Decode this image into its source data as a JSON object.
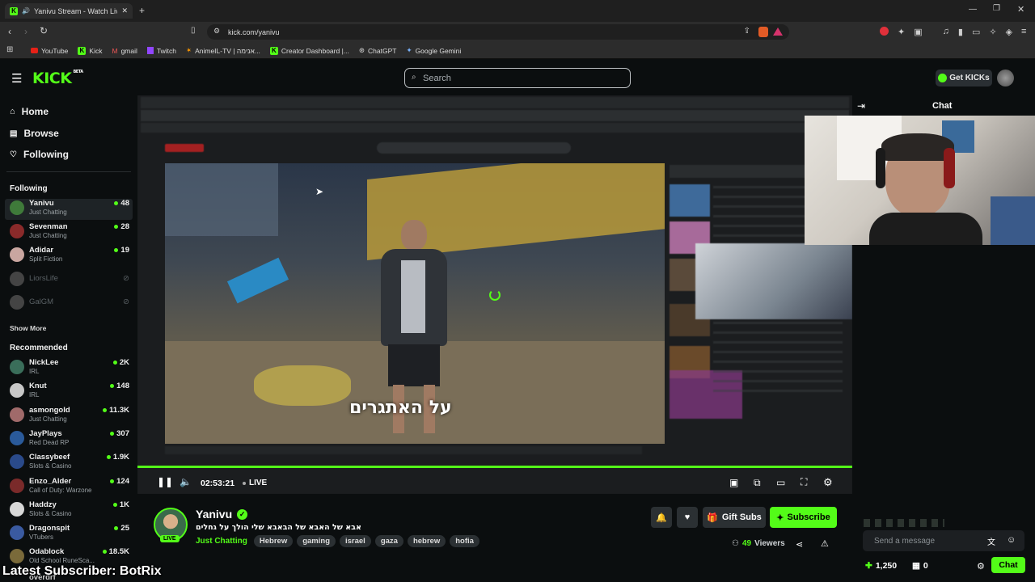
{
  "browser": {
    "tab_title": "Yanivu Stream - Watch Live o",
    "url": "kick.com/yanivu",
    "bookmarks": [
      "YouTube",
      "Kick",
      "gmail",
      "Twitch",
      "AnimeIL-TV | אנימה...",
      "Creator Dashboard |...",
      "ChatGPT",
      "Google Gemini"
    ]
  },
  "header": {
    "logo": "KICK",
    "logo_badge": "BETA",
    "search_placeholder": "Search",
    "get_kicks": "Get KICKs"
  },
  "sidebar": {
    "nav": [
      "Home",
      "Browse",
      "Following"
    ],
    "following_title": "Following",
    "following": [
      {
        "name": "Yanivu",
        "category": "Just Chatting",
        "viewers": "48",
        "color": "#3f7a3a"
      },
      {
        "name": "Sevenman",
        "category": "Just Chatting",
        "viewers": "28",
        "color": "#8a2a2a"
      },
      {
        "name": "Adidar",
        "category": "Split Fiction",
        "viewers": "19",
        "color": "#c9a6a0"
      }
    ],
    "offline": [
      "LiorsLife",
      "GalGM"
    ],
    "show_more": "Show More",
    "recommended_title": "Recommended",
    "recommended": [
      {
        "name": "NickLee",
        "category": "IRL",
        "viewers": "2K",
        "color": "#3a6e5a"
      },
      {
        "name": "Knut",
        "category": "IRL",
        "viewers": "148",
        "color": "#c8c8c8"
      },
      {
        "name": "asmongold",
        "category": "Just Chatting",
        "viewers": "11.3K",
        "color": "#a06a6a"
      },
      {
        "name": "JayPlays",
        "category": "Red Dead RP",
        "viewers": "307",
        "color": "#2a5a9a"
      },
      {
        "name": "Classybeef",
        "category": "Slots & Casino",
        "viewers": "1.9K",
        "color": "#2a4a8a"
      },
      {
        "name": "Enzo_Alder",
        "category": "Call of Duty: Warzone",
        "viewers": "124",
        "color": "#7a2a2a"
      },
      {
        "name": "Haddzy",
        "category": "Slots & Casino",
        "viewers": "1K",
        "color": "#d8d8d8"
      },
      {
        "name": "Dragonspit",
        "category": "VTubers",
        "viewers": "25",
        "color": "#3a5aa0"
      },
      {
        "name": "Odablock",
        "category": "Old School RuneSca...",
        "viewers": "18.5K",
        "color": "#7a6a3a"
      }
    ],
    "cut_off_name": "overdrf"
  },
  "video": {
    "subtitle": "על האתגרים",
    "time": "02:53:21",
    "live_label": "LIVE",
    "overlay_text": "Latest Subscriber: BotRix"
  },
  "stream": {
    "name": "Yanivu",
    "title": "אבא של האבא של הבאבא שלי הולך על גחלים",
    "category": "Just Chatting",
    "tags": [
      "Hebrew",
      "gaming",
      "israel",
      "gaza",
      "hebrew",
      "hofia"
    ],
    "live_badge": "LIVE",
    "viewers": "49",
    "viewers_label": "Viewers",
    "gift_subs": "Gift Subs",
    "subscribe": "Subscribe"
  },
  "chat": {
    "title": "Chat",
    "input_placeholder": "Send a message",
    "points": "1,250",
    "kicks": "0",
    "chat_button": "Chat"
  },
  "colors": {
    "accent": "#53fc18",
    "background": "#0b0e0f"
  }
}
